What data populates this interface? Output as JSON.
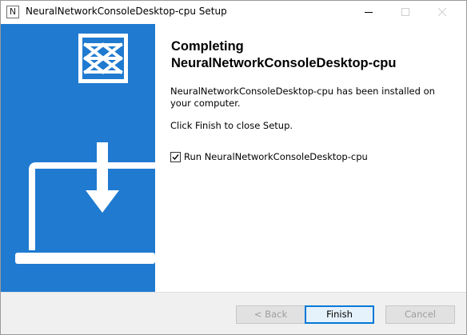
{
  "window": {
    "title": "NeuralNetworkConsoleDesktop-cpu Setup",
    "app_icon_letter": "N"
  },
  "content": {
    "heading_line1": "Completing",
    "heading_line2": "NeuralNetworkConsoleDesktop-cpu",
    "installed_text": "NeuralNetworkConsoleDesktop-cpu has been installed on your computer.",
    "finish_hint": "Click Finish to close Setup.",
    "run_checkbox": {
      "label": "Run NeuralNetworkConsoleDesktop-cpu",
      "checked": true
    }
  },
  "buttons": {
    "back_label": "< Back",
    "finish_label": "Finish",
    "cancel_label": "Cancel"
  },
  "colors": {
    "banner": "#1f7ad0",
    "accent": "#0078d7"
  },
  "icons": [
    "minimize-icon",
    "maximize-icon",
    "close-icon",
    "nnc-logo",
    "download-arrow",
    "laptop"
  ]
}
